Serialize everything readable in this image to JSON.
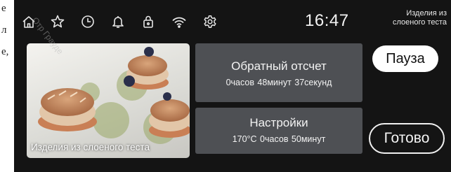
{
  "background_doc": {
    "fragments": [
      "е",
      "л",
      "е,"
    ]
  },
  "watermark": "Отр Граудe",
  "status_bar": {
    "icons": [
      "home-icon",
      "star-icon",
      "clock-icon",
      "bell-icon",
      "lock-icon",
      "wifi-icon",
      "gear-icon"
    ],
    "time": "16:47",
    "program_name_line1": "Изделия из",
    "program_name_line2": "слоеного теста"
  },
  "photo_card": {
    "caption": "Изделия из слоеного теста"
  },
  "countdown": {
    "title": "Обратный отсчет",
    "remaining": "0часов 48минут 37секунд"
  },
  "settings": {
    "title": "Настройки",
    "values": "170°C 0часов 50минут"
  },
  "buttons": {
    "pause": "Пауза",
    "done": "Готово"
  },
  "colors": {
    "screen_bg": "#141414",
    "tile_bg": "#4e5054",
    "text": "#f3f3f3"
  }
}
